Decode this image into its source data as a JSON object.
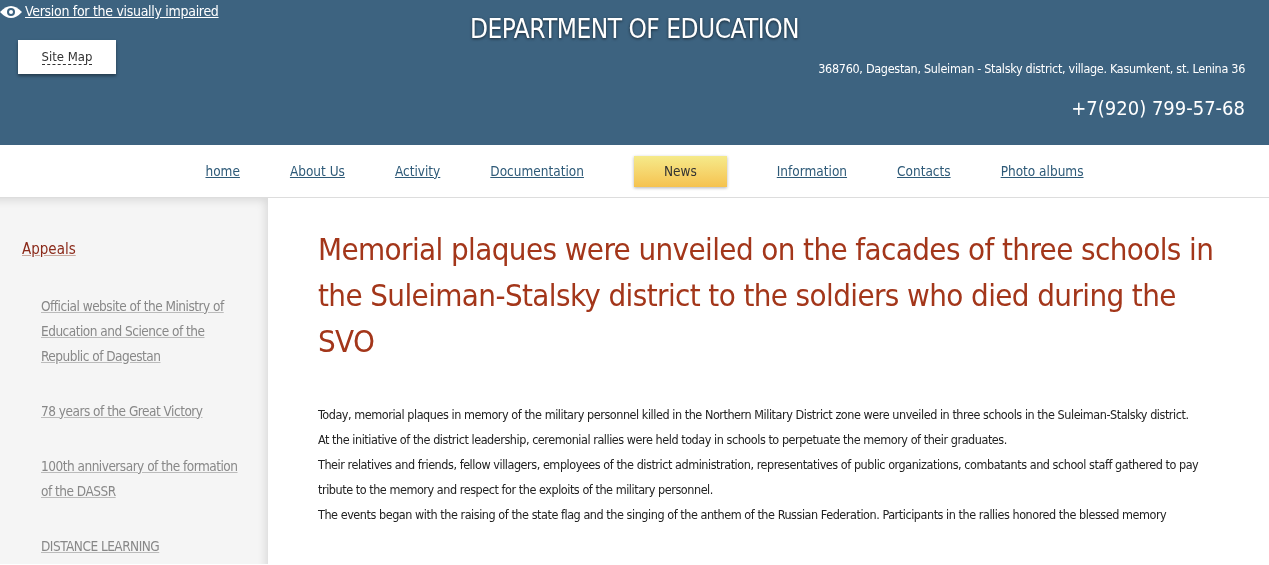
{
  "header": {
    "accessibility_link": "Version for the visually impaired",
    "site_map_button": "Site Map",
    "title": "DEPARTMENT OF EDUCATION",
    "address": "368760, Dagestan, Suleiman - Stalsky district, village. Kasumkent, st. Lenina 36",
    "phone": "+7(920) 799-57-68"
  },
  "nav": [
    {
      "label": "home",
      "selected": false
    },
    {
      "label": "About Us",
      "selected": false
    },
    {
      "label": "Activity",
      "selected": false
    },
    {
      "label": "Documentation",
      "selected": false
    },
    {
      "label": "News",
      "selected": true
    },
    {
      "label": "Information",
      "selected": false
    },
    {
      "label": "Contacts",
      "selected": false
    },
    {
      "label": "Photo albums",
      "selected": false
    }
  ],
  "sidebar": {
    "items": [
      {
        "label": "Appeals",
        "kind": "heading"
      },
      {
        "label": "Official website of the Ministry of Education and Science of the Republic of Dagestan",
        "kind": "link"
      },
      {
        "label": "78 years of the Great Victory",
        "kind": "link"
      },
      {
        "label": "100th anniversary of the formation of the DASSR",
        "kind": "link"
      },
      {
        "label": "DISTANCE LEARNING",
        "kind": "link"
      }
    ]
  },
  "article": {
    "title": "Memorial plaques were unveiled on the facades of three schools in the Suleiman-Stalsky district to the soldiers who died during the SVO",
    "paragraphs": [
      "Today, memorial plaques in memory of the military personnel killed in the Northern Military District zone were unveiled in three schools in the Suleiman-Stalsky district.",
      "At the initiative of the district leadership, ceremonial rallies were held today in schools to perpetuate the memory of their graduates.",
      "Their relatives and friends, fellow villagers, employees of the district administration, representatives of public organizations, combatants and school staff gathered to pay tribute to the memory and respect for the exploits of the military personnel.",
      "The events began with the raising of the state flag and the singing of the anthem of the Russian Federation. Participants in the rallies honored the blessed memory"
    ]
  }
}
